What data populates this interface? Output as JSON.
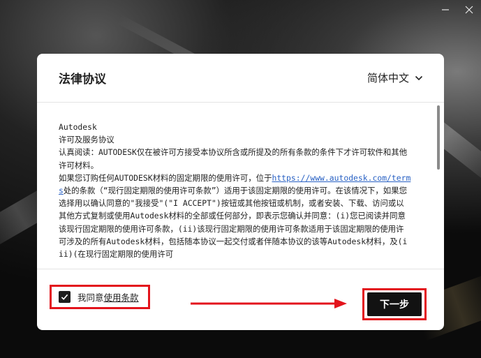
{
  "dialog": {
    "title": "法律协议",
    "language": "简体中文"
  },
  "license": {
    "line1": "Autodesk",
    "line2": "许可及服务协议",
    "line3": "认真阅读：AUTODESK仅在被许可方接受本协议所含或所提及的所有条款的条件下才许可软件和其他许可材料。",
    "line4_pre": "如果您订购任何AUTODESK材料的固定期限的使用许可，位于",
    "line4_link": "https://www.autodesk.com/terms",
    "line4_post": "处的条款（“现行固定期限的使用许可条款”）适用于该固定期限的使用许可。在该情况下，如果您选择用以确认同意的\"我接受\"(\"I ACCEPT\")按钮或其他按钮或机制，或者安装、下载、访问或以其他方式复制或使用Autodesk材料的全部或任何部分，即表示您确认并同意：(i)您已阅读并同意该现行固定期限的使用许可条款，(ii)该现行固定期限的使用许可条款适用于该固定期限的使用许可涉及的所有Autodesk材料，包括随本协议一起交付或者伴随本协议的该等Autodesk材料，及(iii)(在现行固定期限的使用许可"
  },
  "agreement": {
    "prefix": "我同意",
    "link": "使用条款",
    "checked": true
  },
  "buttons": {
    "next": "下一步"
  },
  "colors": {
    "highlight": "#e3141c",
    "button_bg": "#121212",
    "link": "#2a62c4"
  },
  "window_controls": [
    "minimize-icon",
    "close-icon"
  ]
}
